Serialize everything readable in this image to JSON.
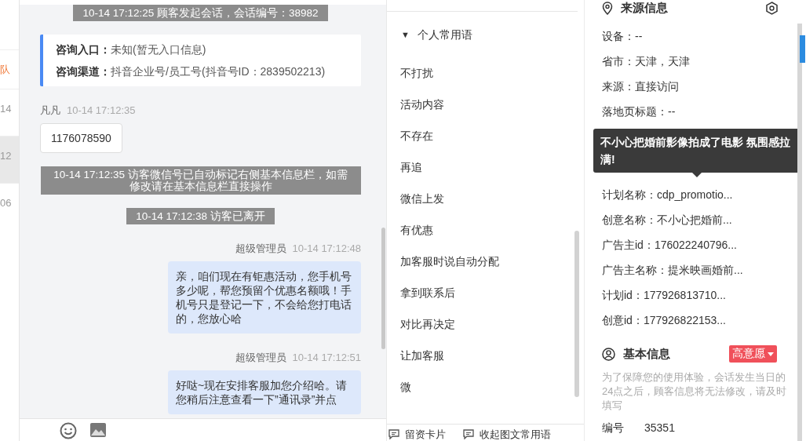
{
  "session_list": {
    "items": [
      {
        "kind": "label",
        "text": "队",
        "selected": false
      },
      {
        "kind": "time",
        "text": "14",
        "selected": false
      },
      {
        "kind": "time",
        "text": "12",
        "selected": true
      },
      {
        "kind": "time",
        "text": "06",
        "selected": false
      }
    ]
  },
  "chat": {
    "messages": [
      {
        "kind": "system",
        "text": "10-14 17:12:25 顾客发起会话，会话编号：38982"
      },
      {
        "kind": "entry",
        "fields": [
          {
            "label": "咨询入口：",
            "value": "未知(暂无入口信息)"
          },
          {
            "label": "咨询渠道：",
            "value": "抖音企业号/员工号(抖音号ID：2839502213)"
          }
        ]
      },
      {
        "kind": "visitor",
        "sender": "凡凡",
        "time": "10-14 17:12:35",
        "text": "1176078590"
      },
      {
        "kind": "system",
        "text": "10-14 17:12:35 访客微信号已自动标记右侧基本信息栏，如需修改请在基本信息栏直接操作"
      },
      {
        "kind": "system",
        "text": "10-14 17:12:38 访客已离开"
      },
      {
        "kind": "agent",
        "sender": "超级管理员",
        "time": "10-14 17:12:48",
        "text": "亲，咱们现在有钜惠活动，您手机号多少呢，帮您预留个优惠名额哦！手机号只是登记一下，不会给您打电话的，您放心哈"
      },
      {
        "kind": "agent",
        "sender": "超级管理员",
        "time": "10-14 17:12:51",
        "text": "好哒~现在安排客服加您介绍哈。请您稍后注意查看一下”通讯录”并点"
      }
    ]
  },
  "phrases": {
    "group": {
      "toggle": "▼",
      "label": "个人常用语",
      "expanded": true
    },
    "items": [
      "不打扰",
      "活动内容",
      "不存在",
      "再追",
      "微信上发",
      "有优惠",
      "加客服时说自动分配",
      "拿到联系后",
      "对比再决定",
      "让加客服",
      "微"
    ],
    "actions": [
      "留资卡片",
      "收起图文常用语"
    ]
  },
  "source_info": {
    "title": "来源信息",
    "rows": [
      "设备：--",
      "省市：天津，天津",
      "来源：直接访问",
      "落地页标题：--"
    ],
    "tooltip": "不小心把婚前影像拍成了电影 氛围感拉满!",
    "rows_after": [
      "计划名称：cdp_promotio...",
      "创意名称：不小心把婚前...",
      "广告主id：176022240796...",
      "广告主名称：提米映画婚前...",
      "计划id：177926813710...",
      "创意id：177926822153..."
    ]
  },
  "basic_info": {
    "title": "基本信息",
    "intent": "高意愿",
    "notice": "为了保障您的使用体验，会话发生当日的24点之后，顾客信息将无法修改，请及时填写",
    "fields": [
      {
        "label": "编号",
        "value": "35351"
      }
    ]
  }
}
